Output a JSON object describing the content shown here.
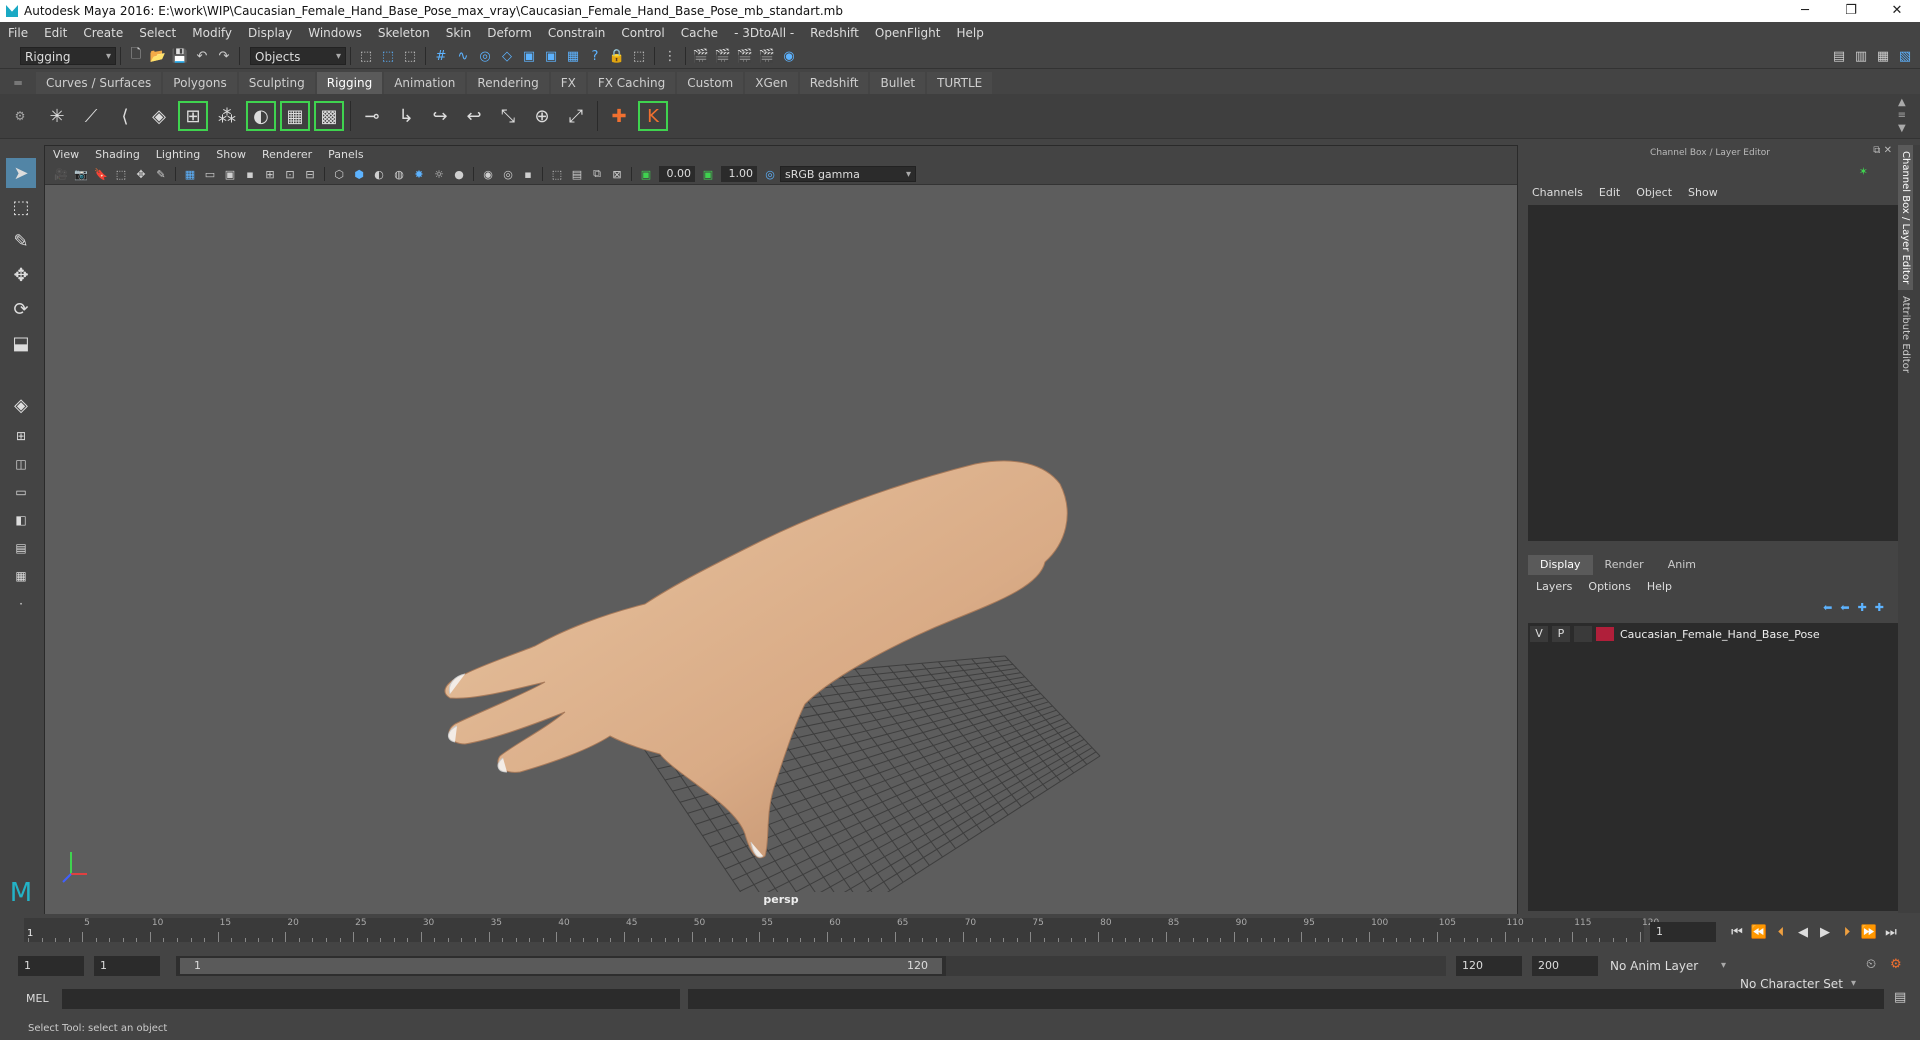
{
  "window": {
    "title": "Autodesk Maya 2016: E:\\work\\WIP\\Caucasian_Female_Hand_Base_Pose_max_vray\\Caucasian_Female_Hand_Base_Pose_mb_standart.mb",
    "minimize": "─",
    "restore": "❐",
    "close": "✕"
  },
  "menu": [
    "File",
    "Edit",
    "Create",
    "Select",
    "Modify",
    "Display",
    "Windows",
    "Skeleton",
    "Skin",
    "Deform",
    "Constrain",
    "Control",
    "Cache",
    "- 3DtoAll -",
    "Redshift",
    "OpenFlight",
    "Help"
  ],
  "statusline": {
    "mode": "Rigging",
    "objects": "Objects"
  },
  "shelf_tabs": [
    "Curves / Surfaces",
    "Polygons",
    "Sculpting",
    "Rigging",
    "Animation",
    "Rendering",
    "FX",
    "FX Caching",
    "Custom",
    "XGen",
    "Redshift",
    "Bullet",
    "TURTLE"
  ],
  "shelf_active": "Rigging",
  "viewport": {
    "menu": [
      "View",
      "Shading",
      "Lighting",
      "Show",
      "Renderer",
      "Panels"
    ],
    "exposure": "0.00",
    "gamma": "1.00",
    "colorspace": "sRGB gamma",
    "camera": "persp"
  },
  "channel_box": {
    "title": "Channel Box / Layer Editor",
    "menu": [
      "Channels",
      "Edit",
      "Object",
      "Show"
    ]
  },
  "layer_editor": {
    "tabs": [
      "Display",
      "Render",
      "Anim"
    ],
    "active_tab": "Display",
    "menu": [
      "Layers",
      "Options",
      "Help"
    ],
    "layers": [
      {
        "v": "V",
        "p": "P",
        "color": "#b01f3a",
        "name": "Caucasian_Female_Hand_Base_Pose"
      }
    ]
  },
  "side_tabs": [
    "Channel Box / Layer Editor",
    "Attribute Editor"
  ],
  "timeline": {
    "ticks": [
      "1",
      "5",
      "10",
      "15",
      "20",
      "25",
      "30",
      "35",
      "40",
      "45",
      "50",
      "55",
      "60",
      "65",
      "70",
      "75",
      "80",
      "85",
      "90",
      "95",
      "100",
      "105",
      "110",
      "115",
      "120"
    ],
    "current_frame": "1"
  },
  "range": {
    "start": "1",
    "playback_start": "1",
    "slider_start": "1",
    "slider_end": "120",
    "playback_end": "120",
    "end": "200",
    "anim_layer": "No Anim Layer",
    "character_set": "No Character Set"
  },
  "mel": {
    "label": "MEL"
  },
  "status": {
    "help": "Select Tool: select an object"
  },
  "colors": {
    "layer_red": "#b01f3a",
    "active_blue": "#5285a6",
    "shelf_green": "#3fd34f",
    "grid": "#3a3a3a"
  }
}
